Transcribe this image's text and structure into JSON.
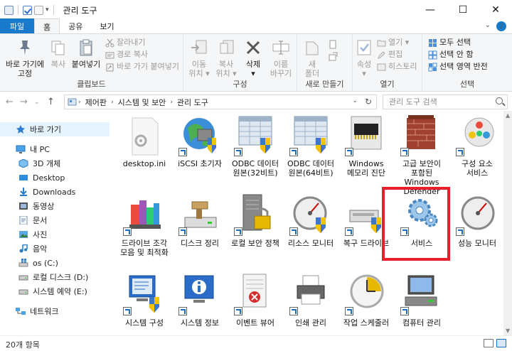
{
  "window": {
    "title": "관리 도구",
    "minimize": "—",
    "maximize": "☐",
    "close": "✕"
  },
  "ribbon_tabs": [
    "파일",
    "홈",
    "공유",
    "보기"
  ],
  "ribbon": {
    "clipboard": {
      "label": "클립보드",
      "pin": [
        "바로 가기에",
        "고정"
      ],
      "copy": "복사",
      "paste": "붙여넣기",
      "cut": "잘라내기",
      "copy_path": "경로 복사",
      "paste_shortcut": "바로 가기 붙여넣기"
    },
    "organize": {
      "label": "구성",
      "move_to": [
        "이동",
        "위치 ▾"
      ],
      "copy_to": [
        "복사",
        "위치 ▾"
      ],
      "delete": [
        "삭제",
        "▾"
      ],
      "rename": [
        "이름",
        "바꾸기"
      ]
    },
    "new": {
      "label": "새로 만들기",
      "new_folder": [
        "새",
        "폴더"
      ]
    },
    "open": {
      "label": "열기",
      "properties": [
        "속성",
        "▾"
      ],
      "open": "열기 ▾",
      "edit": "편집",
      "history": "히스토리"
    },
    "select": {
      "label": "선택",
      "select_all": "모두 선택",
      "select_none": "선택 안 함",
      "invert": "선택 영역 반전"
    }
  },
  "address": {
    "crumbs": [
      "제어판",
      "시스템 및 보안",
      "관리 도구"
    ],
    "search_placeholder": "관리 도구 검색"
  },
  "nav": {
    "items": [
      {
        "label": "바로 가기",
        "icon": "star-icon"
      },
      {
        "label": "내 PC",
        "icon": "computer-icon"
      },
      {
        "label": "3D 개체",
        "icon": "cube-icon"
      },
      {
        "label": "Desktop",
        "icon": "desktop-icon"
      },
      {
        "label": "Downloads",
        "icon": "download-icon"
      },
      {
        "label": "동영상",
        "icon": "video-icon"
      },
      {
        "label": "문서",
        "icon": "document-icon"
      },
      {
        "label": "사진",
        "icon": "picture-icon"
      },
      {
        "label": "음악",
        "icon": "music-icon"
      },
      {
        "label": "os (C:)",
        "icon": "windows-drive-icon"
      },
      {
        "label": "로컬 디스크 (D:)",
        "icon": "drive-icon"
      },
      {
        "label": "시스템 예약 (E:)",
        "icon": "drive-icon"
      },
      {
        "label": "네트워크",
        "icon": "network-icon"
      }
    ]
  },
  "files": [
    {
      "label": "desktop.ini",
      "icon": "settings-file-icon"
    },
    {
      "label": "iSCSI 초기자",
      "icon": "iscsi-globe-icon"
    },
    {
      "label": "ODBC 데이터 원본(32비트)",
      "icon": "odbc-icon"
    },
    {
      "label": "ODBC 데이터 원본(64비트)",
      "icon": "odbc-icon"
    },
    {
      "label": "Windows 메모리 진단",
      "icon": "memory-chip-icon"
    },
    {
      "label": "고급 보안이 포함된 Windows Defender",
      "icon": "firewall-icon"
    },
    {
      "label": "구성 요소 서비스",
      "icon": "component-services-icon"
    },
    {
      "label": "드라이브 조각 모음 및 최적화",
      "icon": "defrag-icon"
    },
    {
      "label": "디스크 정리",
      "icon": "disk-cleanup-icon"
    },
    {
      "label": "로컬 보안 정책",
      "icon": "security-policy-icon"
    },
    {
      "label": "리소스 모니터",
      "icon": "gauge-icon"
    },
    {
      "label": "복구 드라이브",
      "icon": "recovery-drive-icon"
    },
    {
      "label": "서비스",
      "icon": "services-gear-icon"
    },
    {
      "label": "성능 모니터",
      "icon": "gauge-icon"
    },
    {
      "label": "시스템 구성",
      "icon": "system-config-icon"
    },
    {
      "label": "시스템 정보",
      "icon": "system-info-icon"
    },
    {
      "label": "이벤트 뷰어",
      "icon": "event-viewer-icon"
    },
    {
      "label": "인쇄 관리",
      "icon": "printer-icon"
    },
    {
      "label": "작업 스케줄러",
      "icon": "task-scheduler-icon"
    },
    {
      "label": "컴퓨터 관리",
      "icon": "computer-management-icon"
    }
  ],
  "status": {
    "count": "20개 항목"
  },
  "colors": {
    "file_tab": "#1979ca",
    "highlight": "#e8202a",
    "selection": "#e5f3ff"
  }
}
